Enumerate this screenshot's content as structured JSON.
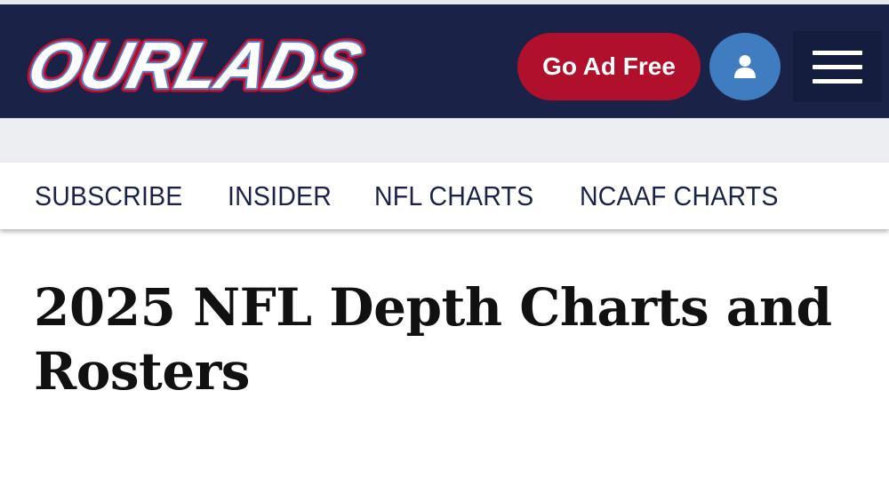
{
  "header": {
    "logo_text": "OURLADS",
    "go_ad_free_label": "Go Ad Free",
    "account_icon": "user-icon",
    "menu_icon": "hamburger-menu-icon",
    "colors": {
      "header_bg": "#1a2347",
      "ad_free_bg": "#b0102b",
      "account_bg": "#3f7cc0",
      "logo_fill": "#ffffff",
      "logo_outline": "#c8102e"
    }
  },
  "nav": {
    "items": [
      {
        "label": "SUBSCRIBE"
      },
      {
        "label": "INSIDER"
      },
      {
        "label": "NFL CHARTS"
      },
      {
        "label": "NCAAF CHARTS"
      }
    ]
  },
  "main": {
    "title": "2025 NFL Depth Charts and Rosters"
  }
}
